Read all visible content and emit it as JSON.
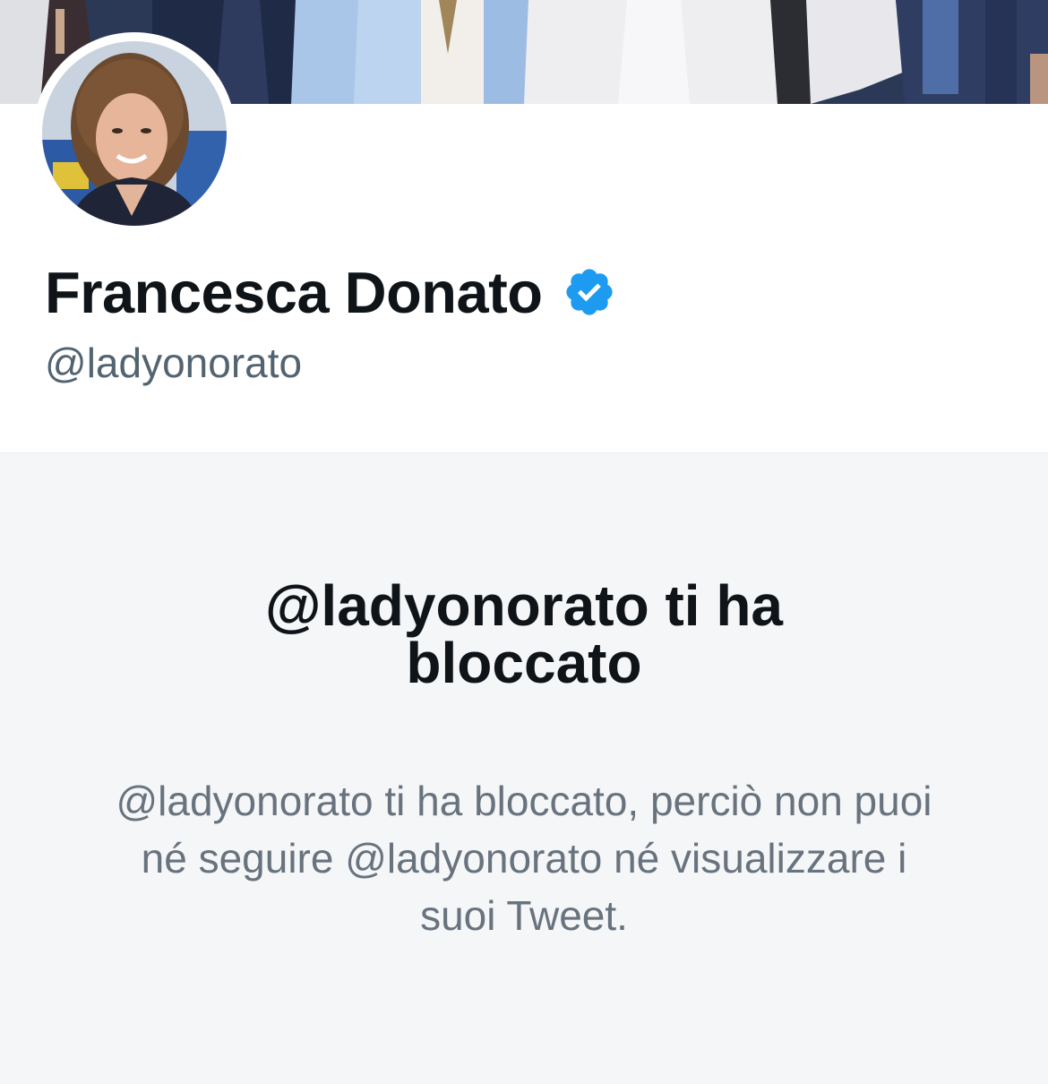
{
  "profile": {
    "display_name": "Francesca Donato",
    "handle": "@ladyonorato",
    "verified": true,
    "avatar_icon": "profile-photo",
    "banner_icon": "banner-photo",
    "verified_icon": "verified-badge-icon"
  },
  "blocked": {
    "title": "@ladyonorato ti ha bloccato",
    "message": "@ladyonorato ti ha bloccato, perciò non puoi né seguire @ladyonorato né visualizzare i suoi Tweet."
  },
  "colors": {
    "verified_blue": "#1d9bf0",
    "text_primary": "#0f1419",
    "text_secondary": "#536471",
    "panel_background": "#f5f6f8"
  }
}
